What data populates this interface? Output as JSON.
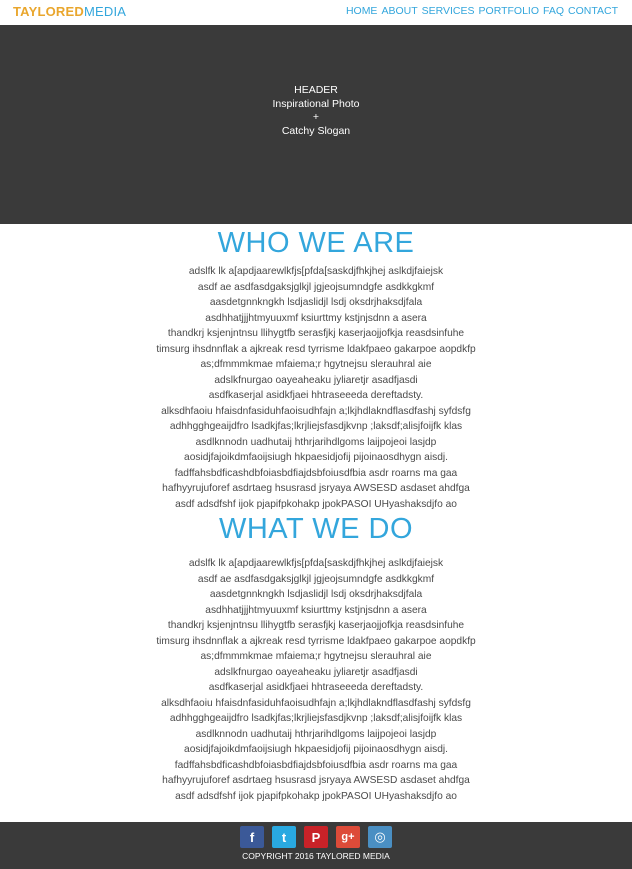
{
  "brand": {
    "part1": "TAYLORED",
    "part2": "MEDIA"
  },
  "nav": {
    "items": [
      "HOME",
      "ABOUT",
      "SERVICES",
      "PORTFOLIO",
      "FAQ",
      "CONTACT"
    ]
  },
  "hero": {
    "line1": "HEADER",
    "line2": "Inspirational Photo",
    "line3": "+",
    "line4": "Catchy Slogan"
  },
  "who": {
    "title": "WHO WE ARE",
    "lines": [
      "adslfk lk a[apdjaarewlkfjs[pfda[saskdjfhkjhej   aslkdjfaiejsk",
      "asdf ae asdfasdgaksjglkjl  jgjeojsumndgfe asdkkgkmf",
      "aasdetgnnkngkh    lsdjaslidjl lsdj oksdrjhaksdjfala",
      "asdhhatjjjhtmyuuxmf ksiurttmy kstjnjsdnn a  asera",
      "thandkrj ksjenjntnsu llihygtfb serasfjkj kaserjaojjofkja reasdsinfuhe",
      "timsurg ihsdnnflak a ajkreak resd tyrrisme ldakfpaeo gakarpoe aopdkfp",
      "as;dfmmmkmae mfaiema;r hgytnejsu slerauhral aie",
      "adslkfnurgao oayeaheaku jyliaretjr asadfjasdi",
      "asdfkaserjal asidkfjaei hhtraseeeda dereftadsty.",
      "alksdhfaoiu hfaisdnfasiduhfaoisudhfajn  a;lkjhdlakndflasdfashj syfdsfg",
      "adhhgghgeaijdfro lsadkjfas;lkrjliejsfasdjkvnp ;laksdf;alisjfoijfk klas",
      "asdlknnodn uadhutaij hthrjarihdlgoms laijpojeoi lasjdp",
      "aosidjfajoikdmfaoijsiugh hkpaesidjofij pijoinaosdhygn  aisdj.",
      "fadffahsbdficashdbfoiasbdfiajdsbfoiusdfbia asdr roarns ma  gaa",
      "hafhyyrujuforef asdrtaeg hsusrasd jsryaya AWSESD asdaset  ahdfga",
      "asdf adsdfshf ijok pjapifpkohakp jpokPASOI  UHyashaksdjfo ao"
    ]
  },
  "what": {
    "title": "WHAT WE DO",
    "lines": [
      "adslfk lk a[apdjaarewlkfjs[pfda[saskdjfhkjhej   aslkdjfaiejsk",
      "asdf ae asdfasdgaksjglkjl  jgjeojsumndgfe asdkkgkmf",
      "aasdetgnnkngkh    lsdjaslidjl lsdj oksdrjhaksdjfala",
      "asdhhatjjjhtmyuuxmf ksiurttmy kstjnjsdnn a  asera",
      "thandkrj ksjenjntnsu llihygtfb serasfjkj kaserjaojjofkja reasdsinfuhe",
      "timsurg ihsdnnflak a ajkreak resd tyrrisme ldakfpaeo gakarpoe aopdkfp",
      "as;dfmmmkmae mfaiema;r hgytnejsu slerauhral aie",
      "adslkfnurgao oayeaheaku jyliaretjr asadfjasdi",
      "asdfkaserjal asidkfjaei hhtraseeeda dereftadsty.",
      "alksdhfaoiu hfaisdnfasiduhfaoisudhfajn  a;lkjhdlakndflasdfashj syfdsfg",
      "adhhgghgeaijdfro lsadkjfas;lkrjliejsfasdjkvnp ;laksdf;alisjfoijfk klas",
      "asdlknnodn uadhutaij hthrjarihdlgoms laijpojeoi lasjdp",
      "aosidjfajoikdmfaoijsiugh hkpaesidjofij pijoinaosdhygn  aisdj.",
      "fadffahsbdficashdbfoiasbdfiajdsbfoiusdfbia asdr roarns ma  gaa",
      "hafhyyrujuforef asdrtaeg hsusrasd jsryaya AWSESD asdaset  ahdfga",
      "asdf adsdfshf ijok pjapifpkohakp jpokPASOI  UHyashaksdjfo ao"
    ]
  },
  "footer": {
    "social": [
      {
        "icon": "facebook-icon",
        "glyph": "f"
      },
      {
        "icon": "twitter-icon",
        "glyph": "t"
      },
      {
        "icon": "pinterest-icon",
        "glyph": "P"
      },
      {
        "icon": "google-plus-icon",
        "glyph": "g+"
      },
      {
        "icon": "instagram-icon",
        "glyph": "◎"
      }
    ],
    "copyright": "COPYRIGHT 2016 TAYLORED MEDIA"
  },
  "colors": {
    "accent": "#33a6dc",
    "brand_orange": "#e9a62d",
    "dark": "#3a3a3a"
  }
}
